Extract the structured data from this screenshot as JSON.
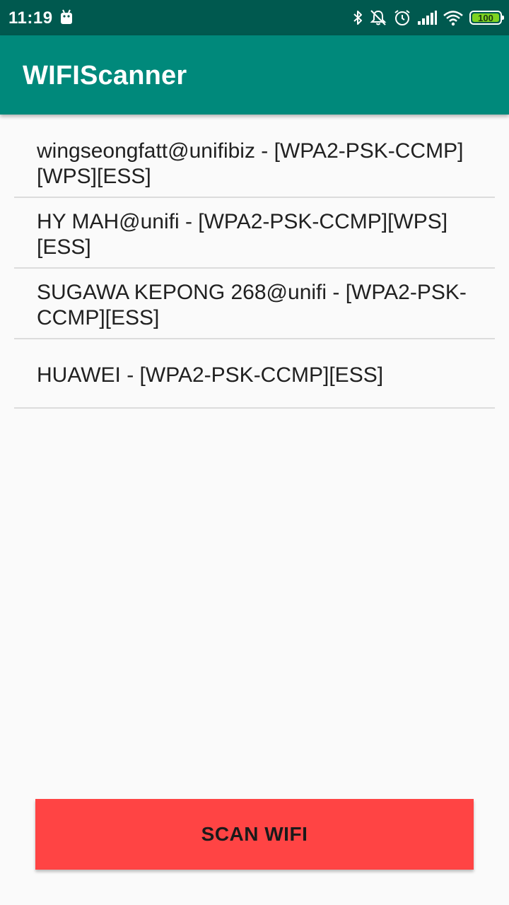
{
  "status_bar": {
    "time": "11:19",
    "battery_level": "100",
    "icons": [
      "android-icon",
      "bluetooth-icon",
      "notifications-off-icon",
      "alarm-icon",
      "signal-icon",
      "wifi-icon",
      "battery-icon"
    ]
  },
  "app_bar": {
    "title": "WIFIScanner"
  },
  "networks": [
    {
      "label": "wingseongfatt@unifibiz - [WPA2-PSK-CCMP][WPS][ESS]"
    },
    {
      "label": "HY MAH@unifi - [WPA2-PSK-CCMP][WPS][ESS]"
    },
    {
      "label": "SUGAWA KEPONG 268@unifi - [WPA2-PSK-CCMP][ESS]"
    },
    {
      "label": "HUAWEI - [WPA2-PSK-CCMP][ESS]"
    }
  ],
  "scan_button": {
    "label": "SCAN WIFI"
  },
  "colors": {
    "status_bar": "#00594f",
    "app_bar": "#00897b",
    "button": "#ff4444",
    "battery_fill": "#7ed321"
  }
}
